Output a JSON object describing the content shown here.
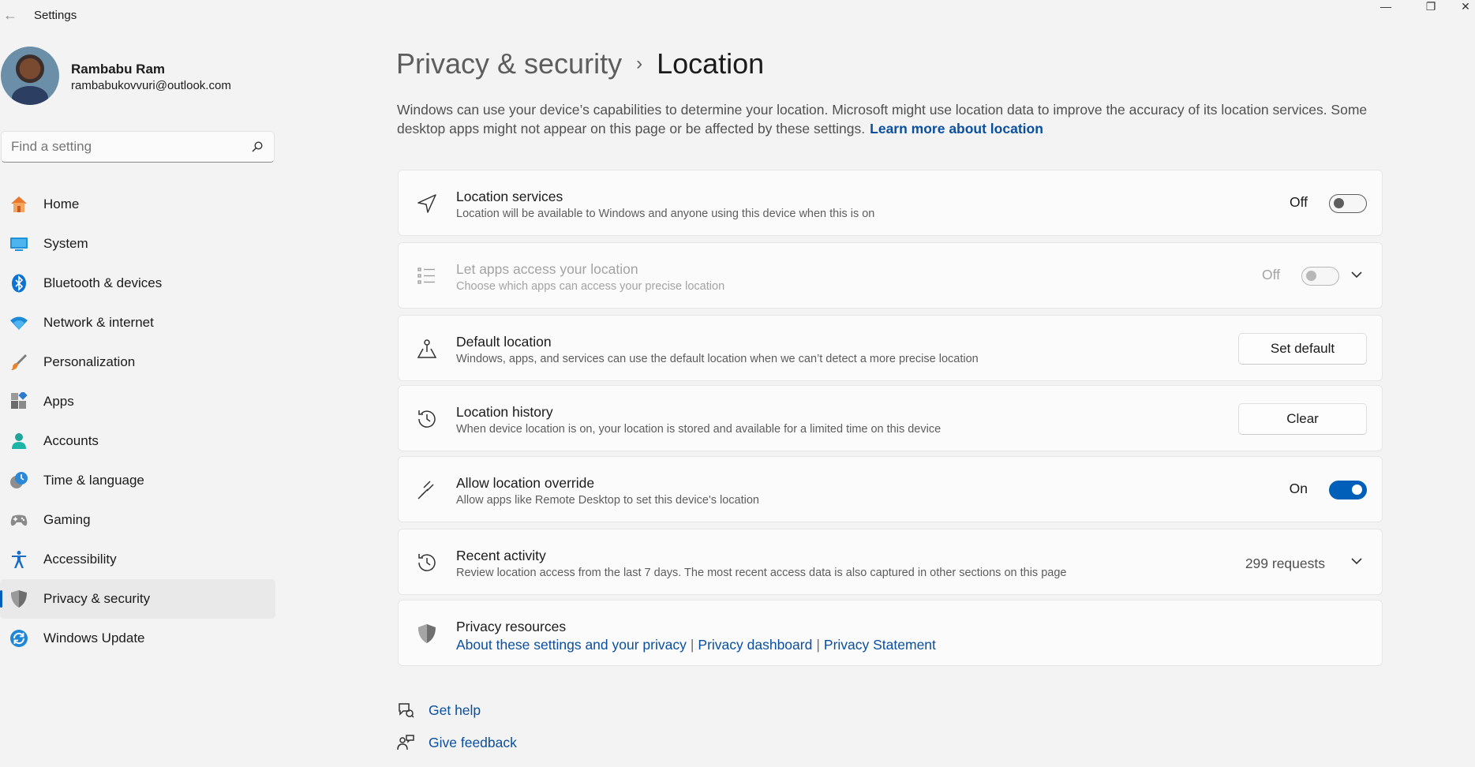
{
  "window": {
    "title": "Settings",
    "back_glyph": "←",
    "min_glyph": "—",
    "max_glyph": "❐",
    "close_glyph": "✕"
  },
  "profile": {
    "name": "Rambabu Ram",
    "email": "rambabukovvuri@outlook.com"
  },
  "search": {
    "placeholder": "Find a setting"
  },
  "sidebar": {
    "items": [
      {
        "label": "Home",
        "icon": "home-icon"
      },
      {
        "label": "System",
        "icon": "system-icon"
      },
      {
        "label": "Bluetooth & devices",
        "icon": "bluetooth-icon"
      },
      {
        "label": "Network & internet",
        "icon": "wifi-icon"
      },
      {
        "label": "Personalization",
        "icon": "brush-icon"
      },
      {
        "label": "Apps",
        "icon": "apps-icon"
      },
      {
        "label": "Accounts",
        "icon": "accounts-icon"
      },
      {
        "label": "Time & language",
        "icon": "clock-globe-icon"
      },
      {
        "label": "Gaming",
        "icon": "gamepad-icon"
      },
      {
        "label": "Accessibility",
        "icon": "accessibility-icon"
      },
      {
        "label": "Privacy & security",
        "icon": "shield-icon",
        "active": true
      },
      {
        "label": "Windows Update",
        "icon": "update-icon"
      }
    ]
  },
  "breadcrumb": {
    "parent": "Privacy & security",
    "separator": "›",
    "current": "Location"
  },
  "description": {
    "text": "Windows can use your device’s capabilities to determine your location. Microsoft might use location data to improve the accuracy of its location services. Some desktop apps might not appear on this page or be affected by these settings.",
    "link": "Learn more about location"
  },
  "cards": {
    "location_services": {
      "title": "Location services",
      "subtitle": "Location will be available to Windows and anyone using this device when this is on",
      "state_label": "Off",
      "on": false,
      "icon": "navigation-arrow-icon"
    },
    "apps_access": {
      "title": "Let apps access your location",
      "subtitle": "Choose which apps can access your precise location",
      "state_label": "Off",
      "on": false,
      "disabled": true,
      "icon": "list-icon"
    },
    "default_location": {
      "title": "Default location",
      "subtitle": "Windows, apps, and services can use the default location when we can’t detect a more precise location",
      "button": "Set default",
      "icon": "map-pin-person-icon"
    },
    "location_history": {
      "title": "Location history",
      "subtitle": "When device location is on, your location is stored and available for a limited time on this device",
      "button": "Clear",
      "icon": "history-icon"
    },
    "location_override": {
      "title": "Allow location override",
      "subtitle": "Allow apps like Remote Desktop to set this device's location",
      "state_label": "On",
      "on": true,
      "icon": "remote-desktop-icon"
    },
    "recent_activity": {
      "title": "Recent activity",
      "subtitle": "Review location access from the last 7 days. The most recent access data is also captured in other sections on this page",
      "count": "299 requests",
      "icon": "history-icon"
    },
    "privacy_resources": {
      "title": "Privacy resources",
      "links": [
        "About these settings and your privacy",
        "Privacy dashboard",
        "Privacy Statement"
      ],
      "link_separator": "|",
      "icon": "shield-icon"
    }
  },
  "help": {
    "get_help": "Get help",
    "give_feedback": "Give feedback"
  },
  "colors": {
    "accent": "#005fb8",
    "link": "#0a4fa0",
    "background": "#f3f3f3",
    "card": "#fbfbfb"
  }
}
